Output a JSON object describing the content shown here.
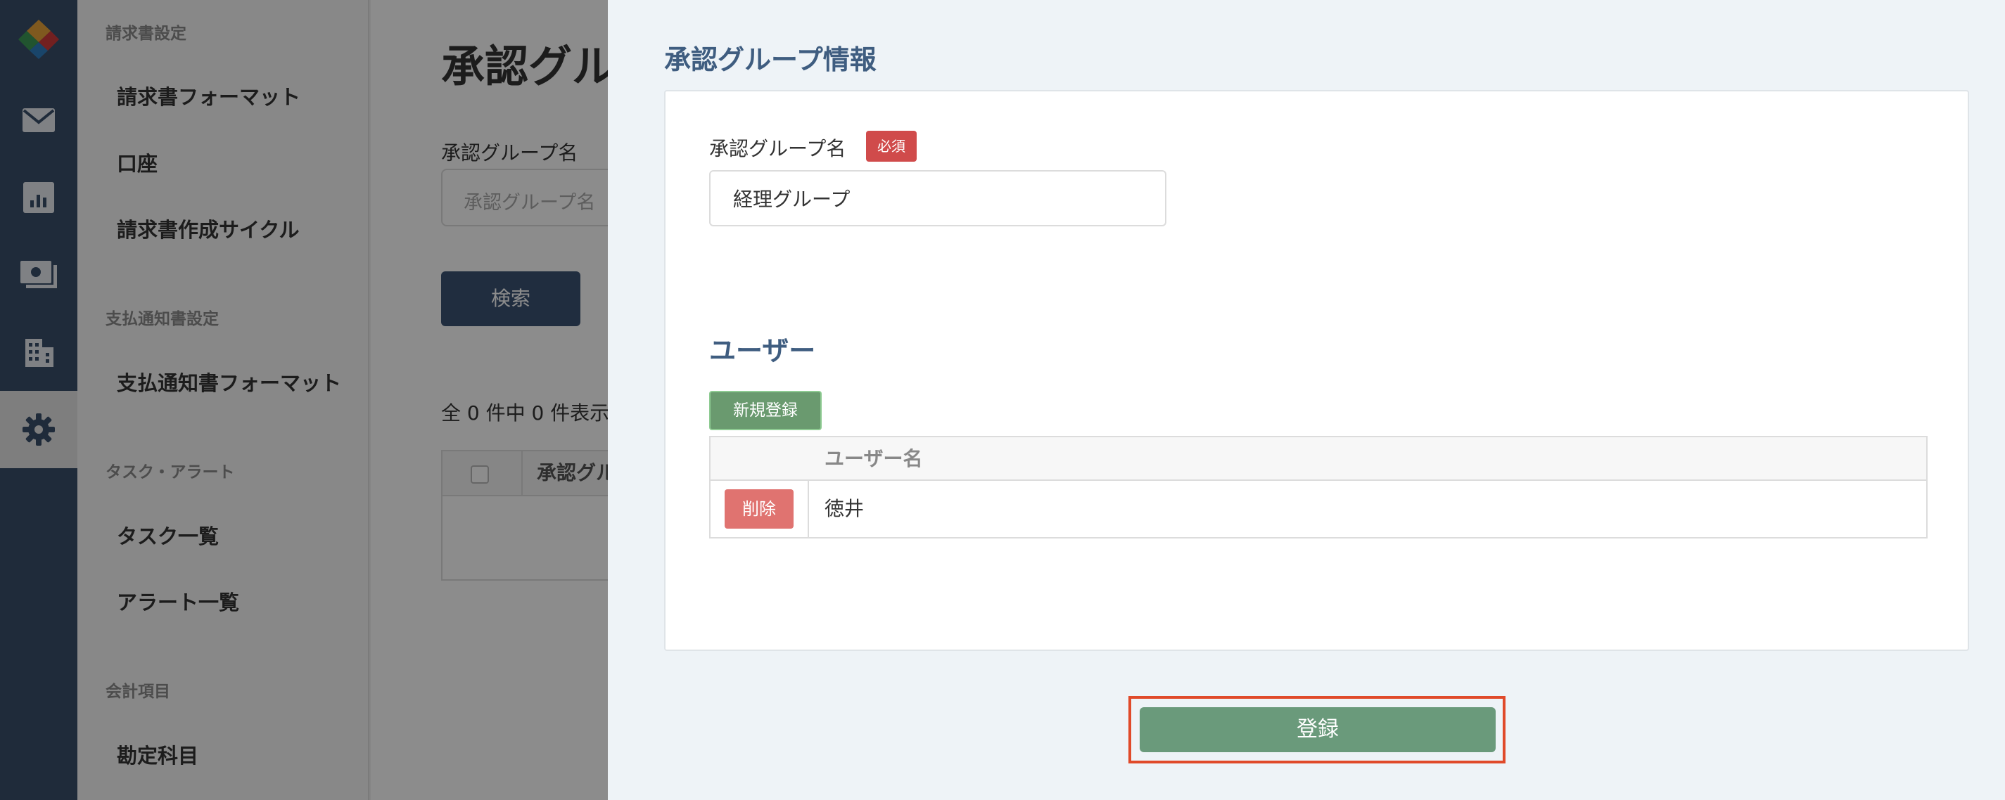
{
  "sidebar": {
    "sections": [
      {
        "heading": "請求書設定",
        "items": [
          "請求書フォーマット",
          "口座",
          "請求書作成サイクル"
        ]
      },
      {
        "heading": "支払通知書設定",
        "items": [
          "支払通知書フォーマット"
        ]
      },
      {
        "heading": "タスク・アラート",
        "items": [
          "タスク一覧",
          "アラート一覧"
        ]
      },
      {
        "heading": "会計項目",
        "items": [
          "勘定科目"
        ]
      }
    ]
  },
  "rail": {
    "icons": [
      "app-logo-icon",
      "mail-icon",
      "chart-icon",
      "payment-icon",
      "building-icon",
      "gear-icon"
    ],
    "active": "gear-icon"
  },
  "background_page": {
    "title": "承認グル",
    "search_label": "承認グループ名",
    "search_placeholder": "承認グループ名",
    "search_button": "検索",
    "result_count": "全 0 件中 0 件表示し",
    "table_column": "承認グル"
  },
  "modal": {
    "title": "承認グループ情報",
    "field_label": "承認グループ名",
    "required_badge": "必須",
    "group_name_value": "経理グループ",
    "users_heading": "ユーザー",
    "add_button": "新規登録",
    "user_table": {
      "column_header": "ユーザー名",
      "rows": [
        {
          "delete_label": "削除",
          "name": "徳井"
        }
      ]
    },
    "submit_button": "登録"
  },
  "colors": {
    "rail": "#3a4f6b",
    "accent_title": "#3f5d80",
    "required": "#d04b4b",
    "add_green": "#6a9a6f",
    "delete_red": "#e07370",
    "submit_green": "#6a9a7b",
    "highlight_frame": "#e04a2a"
  }
}
